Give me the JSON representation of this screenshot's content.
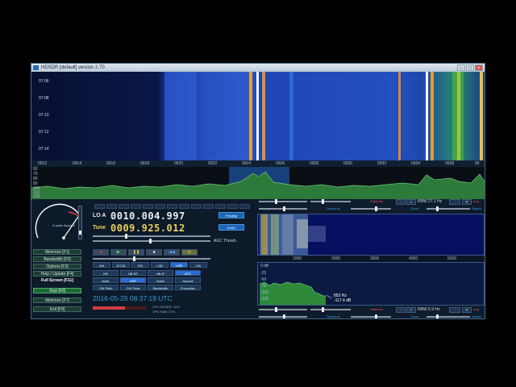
{
  "window": {
    "title": "HDSDR [default]  version 2.70"
  },
  "waterfall": {
    "times": [
      "07:06",
      "07:08",
      "07:10",
      "07:12",
      "07:14"
    ],
    "freq_axis": [
      "0912",
      "0914",
      "0916",
      "0918",
      "0920",
      "0922",
      "0924",
      "0926",
      "0928",
      "0930",
      "0932",
      "0934",
      "0936",
      "05"
    ]
  },
  "spectrum": {
    "db_labels": [
      "60",
      "70",
      "80",
      "90",
      "100",
      "110",
      "120"
    ]
  },
  "smeter": {
    "caption": "S-units Squelch"
  },
  "left_buttons": [
    {
      "label": "Minimize"
    },
    {
      "label": "Bandwidth"
    },
    {
      "label": "Options"
    },
    {
      "label": "Help / Update"
    },
    {
      "label": "Full Screen"
    },
    {
      "label": "Stop"
    },
    {
      "label": "Minimize"
    },
    {
      "label": "Exit"
    }
  ],
  "key_hints": [
    "[F1]",
    "[F2]",
    "[F3]",
    "[F4]",
    "[F11]",
    "[F8]",
    "[F7]",
    "[F9]"
  ],
  "lo": {
    "label": "LO A",
    "value": "0010.004.997"
  },
  "tune": {
    "label": "Tune",
    "value": "0009.925.012"
  },
  "side_buttons": {
    "freqmgr": "FreqMgr",
    "extio": "ExtIO"
  },
  "agc_label": "AGC Thresh.",
  "modes": [
    "AM",
    "ECSS",
    "FM",
    "LSB",
    "USB",
    "CW",
    "DRM",
    "AFC"
  ],
  "options_row1": [
    "NR",
    "NB RF",
    "NB IF",
    "AFC"
  ],
  "options_row2": [
    "Mute",
    "ANF",
    "Notch",
    "Hauroti"
  ],
  "options_row3": [
    "CW Pitch",
    "CW Peak",
    "Bandwidth",
    "Properties"
  ],
  "datetime": "2016-05-29  08:37:19 UTC",
  "cpu": {
    "hdsdr": "CPU HDSDR: 14%",
    "total": "CPU Total: 31%"
  },
  "rf_controls": {
    "label": "Waterfall",
    "rbw": "RBW 27.1 Hz",
    "zoom": "Zoom",
    "spectrum": "Spectrum",
    "avg": "Avg",
    "speed": "Speed"
  },
  "af_controls": {
    "label": "Waterfall",
    "rbw": "RBW 5.9 Hz",
    "zoom": "Zoom",
    "spectrum": "Spectrum",
    "avg": "Avg",
    "speed": "Speed"
  },
  "af_axis": [
    "1000",
    "2000",
    "3000",
    "4000",
    "5000"
  ],
  "af_db": [
    "0 dB",
    "-25",
    "-50",
    "-75",
    "-100",
    "-120"
  ],
  "af_marker": {
    "hz": "853 Hz",
    "db": "-117.4 dB"
  }
}
